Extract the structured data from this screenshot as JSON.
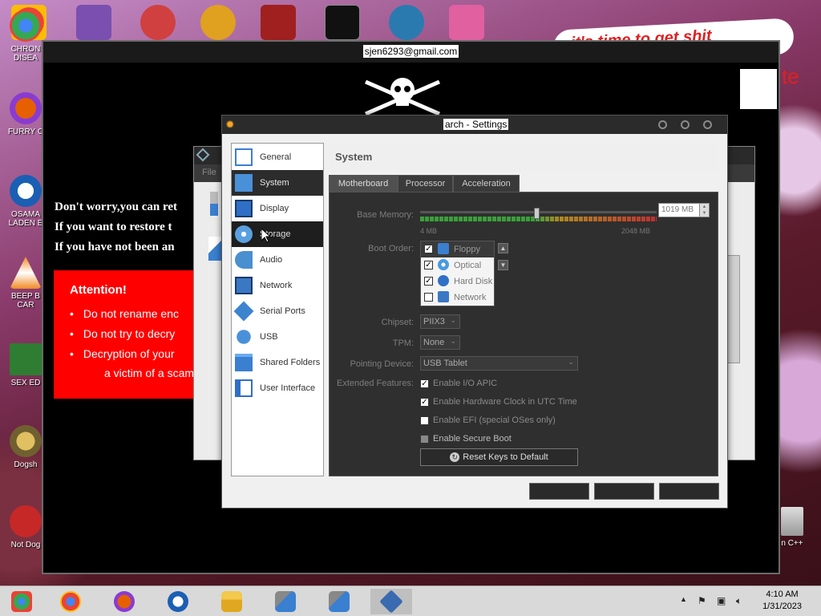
{
  "desktop": {
    "icons": [
      {
        "label": "CHRON\nDISEA",
        "color": "#34a853"
      },
      {
        "label": "FURRY C",
        "color": "#e66000"
      },
      {
        "label": "OSAMA\nLADEN E",
        "color": "#1a5fb4"
      },
      {
        "label": "BEEP B\nCAR",
        "color": "#f08a24"
      },
      {
        "label": "SEX ED",
        "color": "#2e7d32"
      },
      {
        "label": "Dogsh",
        "color": "#b08a20"
      },
      {
        "label": "Not Dog",
        "color": "#c62828"
      }
    ],
    "right_icon_label": "n C++",
    "banner_text": "it's time to get shit",
    "banner_partial": "te"
  },
  "ransom": {
    "title": "sjen6293@gmail.com",
    "lines": [
      "Don't worry,you can ret",
      "If you want to restore t",
      "If you have not been an"
    ],
    "attention_title": "Attention!",
    "attention_items": [
      "Do not rename enc",
      "Do not try to decry",
      "Decryption of your"
    ],
    "attention_tail": "a victim of a scam."
  },
  "vbox_manager": {
    "menu_file": "File"
  },
  "settings": {
    "title": "arch - Settings",
    "categories": [
      {
        "label": "General",
        "icon": "general-icon",
        "color": "#3b7dd8"
      },
      {
        "label": "System",
        "icon": "system-icon",
        "color": "#4a90d9"
      },
      {
        "label": "Display",
        "icon": "display-icon",
        "color": "#2f6fc6"
      },
      {
        "label": "Storage",
        "icon": "storage-icon",
        "color": "#5aa0e0"
      },
      {
        "label": "Audio",
        "icon": "audio-icon",
        "color": "#4a8fd0"
      },
      {
        "label": "Network",
        "icon": "network-icon",
        "color": "#3a78c4"
      },
      {
        "label": "Serial Ports",
        "icon": "serial-ports-icon",
        "color": "#3d84cf"
      },
      {
        "label": "USB",
        "icon": "usb-icon",
        "color": "#4a90d9"
      },
      {
        "label": "Shared Folders",
        "icon": "shared-folders-icon",
        "color": "#3a7fd0"
      },
      {
        "label": "User Interface",
        "icon": "user-interface-icon",
        "color": "#2f6fc6"
      }
    ],
    "selected_category": "System",
    "hovered_category": "Storage",
    "section_title": "System",
    "tabs": [
      "Motherboard",
      "Processor",
      "Acceleration"
    ],
    "active_tab": "Motherboard",
    "motherboard": {
      "base_memory_label": "Base Memory:",
      "base_memory_value": "1019 MB",
      "base_memory_fraction": 0.49,
      "memory_min": "4 MB",
      "memory_max": "2048 MB",
      "boot_order_label": "Boot Order:",
      "boot_order": [
        {
          "label": "Floppy",
          "checked": true,
          "icon": "floppy-icon"
        },
        {
          "label": "Optical",
          "checked": true,
          "icon": "optical-icon"
        },
        {
          "label": "Hard Disk",
          "checked": true,
          "icon": "hard-disk-icon"
        },
        {
          "label": "Network",
          "checked": false,
          "icon": "network-icon"
        }
      ],
      "chipset_label": "Chipset:",
      "chipset_value": "PIIX3",
      "tpm_label": "TPM:",
      "tpm_value": "None",
      "pointing_device_label": "Pointing Device:",
      "pointing_device_value": "USB Tablet",
      "extended_features_label": "Extended Features:",
      "features": [
        {
          "label": "Enable I/O APIC",
          "checked": true
        },
        {
          "label": "Enable Hardware Clock in UTC Time",
          "checked": true
        },
        {
          "label": "Enable EFI (special OSes only)",
          "checked": false
        },
        {
          "label": "Enable Secure Boot",
          "checked": false,
          "disabled": true
        }
      ],
      "reset_keys_label": "Reset Keys to Default"
    }
  },
  "taskbar": {
    "clock_time": "4:10 AM",
    "clock_date": "1/31/2023",
    "apps": [
      "chrome-rdp-icon",
      "chrome-icon",
      "firefox-icon",
      "obama-icon",
      "file-explorer-icon",
      "installer-icon",
      "installer-icon",
      "virtualbox-icon"
    ],
    "active_app": "virtualbox-icon"
  },
  "colors": {
    "ransom_red": "#ff0000",
    "dark_panel": "#2f2f2f",
    "selection": "#2c2c2c"
  }
}
